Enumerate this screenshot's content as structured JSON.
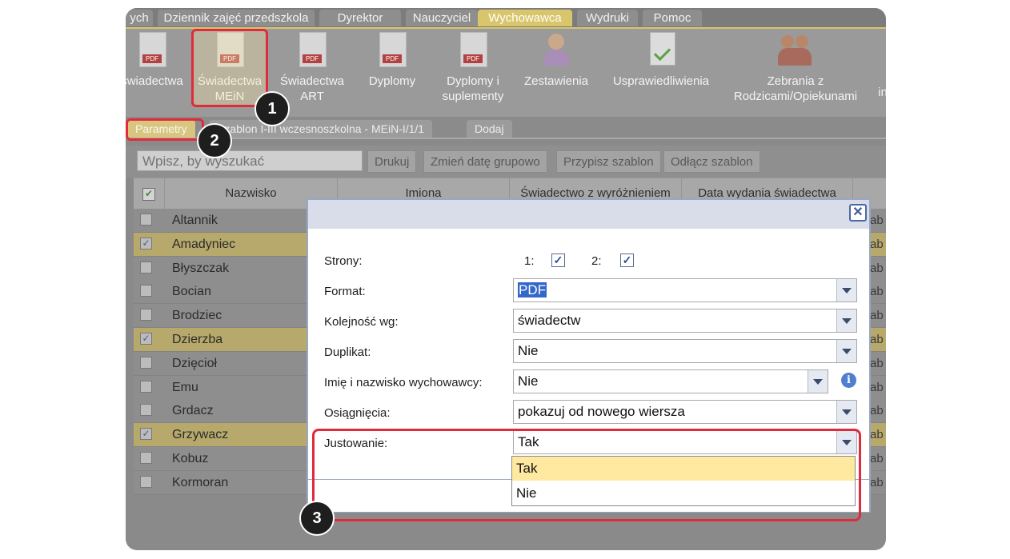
{
  "menu": [
    "ych",
    "Dziennik zajęć przedszkola",
    "Dyrektor",
    "Nauczyciel",
    "Wychowawca",
    "Wydruki",
    "Pomoc"
  ],
  "ribbon": [
    "świadectwa",
    "Świadectwa\nMEiN",
    "Świadectwa\nART",
    "Dyplomy",
    "Dyplomy i\nsuplementy",
    "Zestawienia",
    "Usprawiedliwienia",
    "Zebrania z\nRodzicami/Opiekunami",
    "in"
  ],
  "tabs": [
    "Parametry",
    "Szablon I-III wczesnoszkolna - MEiN-I/1/1",
    "Dodaj"
  ],
  "toolbar": {
    "search_placeholder": "Wpisz, by wyszukać",
    "buttons": [
      "Drukuj",
      "Zmień datę grupowo",
      "Przypisz szablon",
      "Odłącz szablon"
    ]
  },
  "grid": {
    "columns": [
      "Nazwisko",
      "Imiona",
      "Świadectwo z wyróżnieniem",
      "Data wydania świadectwa"
    ],
    "rows": [
      {
        "name": "Altannik",
        "checked": false
      },
      {
        "name": "Amadyniec",
        "checked": true
      },
      {
        "name": "Błyszczak",
        "checked": false
      },
      {
        "name": "Bocian",
        "checked": false
      },
      {
        "name": "Brodziec",
        "checked": false
      },
      {
        "name": "Dzierzba",
        "checked": true
      },
      {
        "name": "Dzięcioł",
        "checked": false
      },
      {
        "name": "Emu",
        "checked": false
      },
      {
        "name": "Grdacz",
        "checked": false
      },
      {
        "name": "Grzywacz",
        "checked": true
      },
      {
        "name": "Kobuz",
        "checked": false
      },
      {
        "name": "Kormoran",
        "checked": false
      }
    ],
    "right_fragment": "ab"
  },
  "dialog": {
    "close_glyph": "✕",
    "strony_label": "Strony:",
    "strony_1": "1:",
    "strony_2": "2:",
    "format_label": "Format:",
    "format_value": "PDF",
    "kolejnosc_label": "Kolejność wg:",
    "kolejnosc_value": "świadectw",
    "duplikat_label": "Duplikat:",
    "duplikat_value": "Nie",
    "imie_label": "Imię i nazwisko wychowawcy:",
    "imie_value": "Nie",
    "osiagniecia_label": "Osiągnięcia:",
    "osiagniecia_value": "pokazuj od nowego wiersza",
    "justowanie_label": "Justowanie:",
    "justowanie_value": "Tak",
    "options": [
      "Tak",
      "Nie"
    ]
  },
  "badges": [
    "1",
    "2",
    "3"
  ],
  "colors": {
    "highlight": "#e02b3c",
    "accent": "#d8c56c",
    "option_hover": "#ffe8a0"
  }
}
